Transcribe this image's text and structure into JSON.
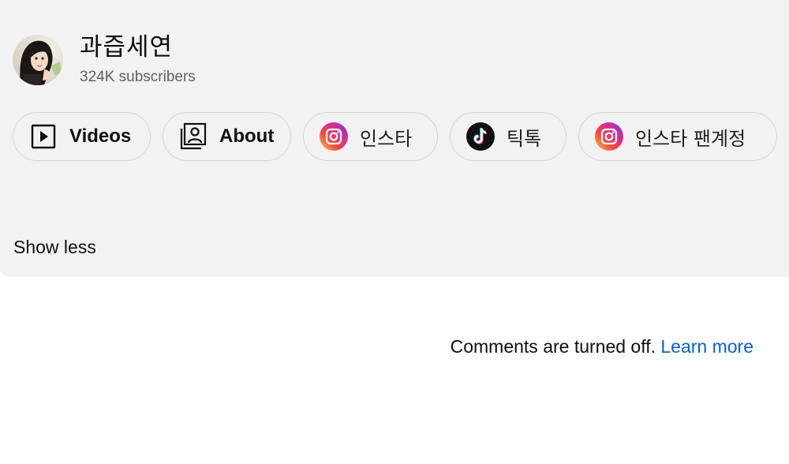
{
  "channel": {
    "name": "과즙세연",
    "subscribers": "324K subscribers"
  },
  "links": [
    {
      "label": "Videos",
      "icon": "play-box-icon"
    },
    {
      "label": "About",
      "icon": "profile-card-icon"
    },
    {
      "label": "인스타",
      "icon": "instagram-icon"
    },
    {
      "label": "틱톡",
      "icon": "tiktok-icon"
    },
    {
      "label": "인스타 팬계정",
      "icon": "instagram-icon"
    }
  ],
  "show_less_label": "Show less",
  "comments": {
    "notice": "Comments are turned off.",
    "learn_more": "Learn more"
  },
  "colors": {
    "panel_bg": "#f2f2f2",
    "link_blue": "#065fd4",
    "text_primary": "#0f0f0f",
    "text_secondary": "#606060"
  }
}
